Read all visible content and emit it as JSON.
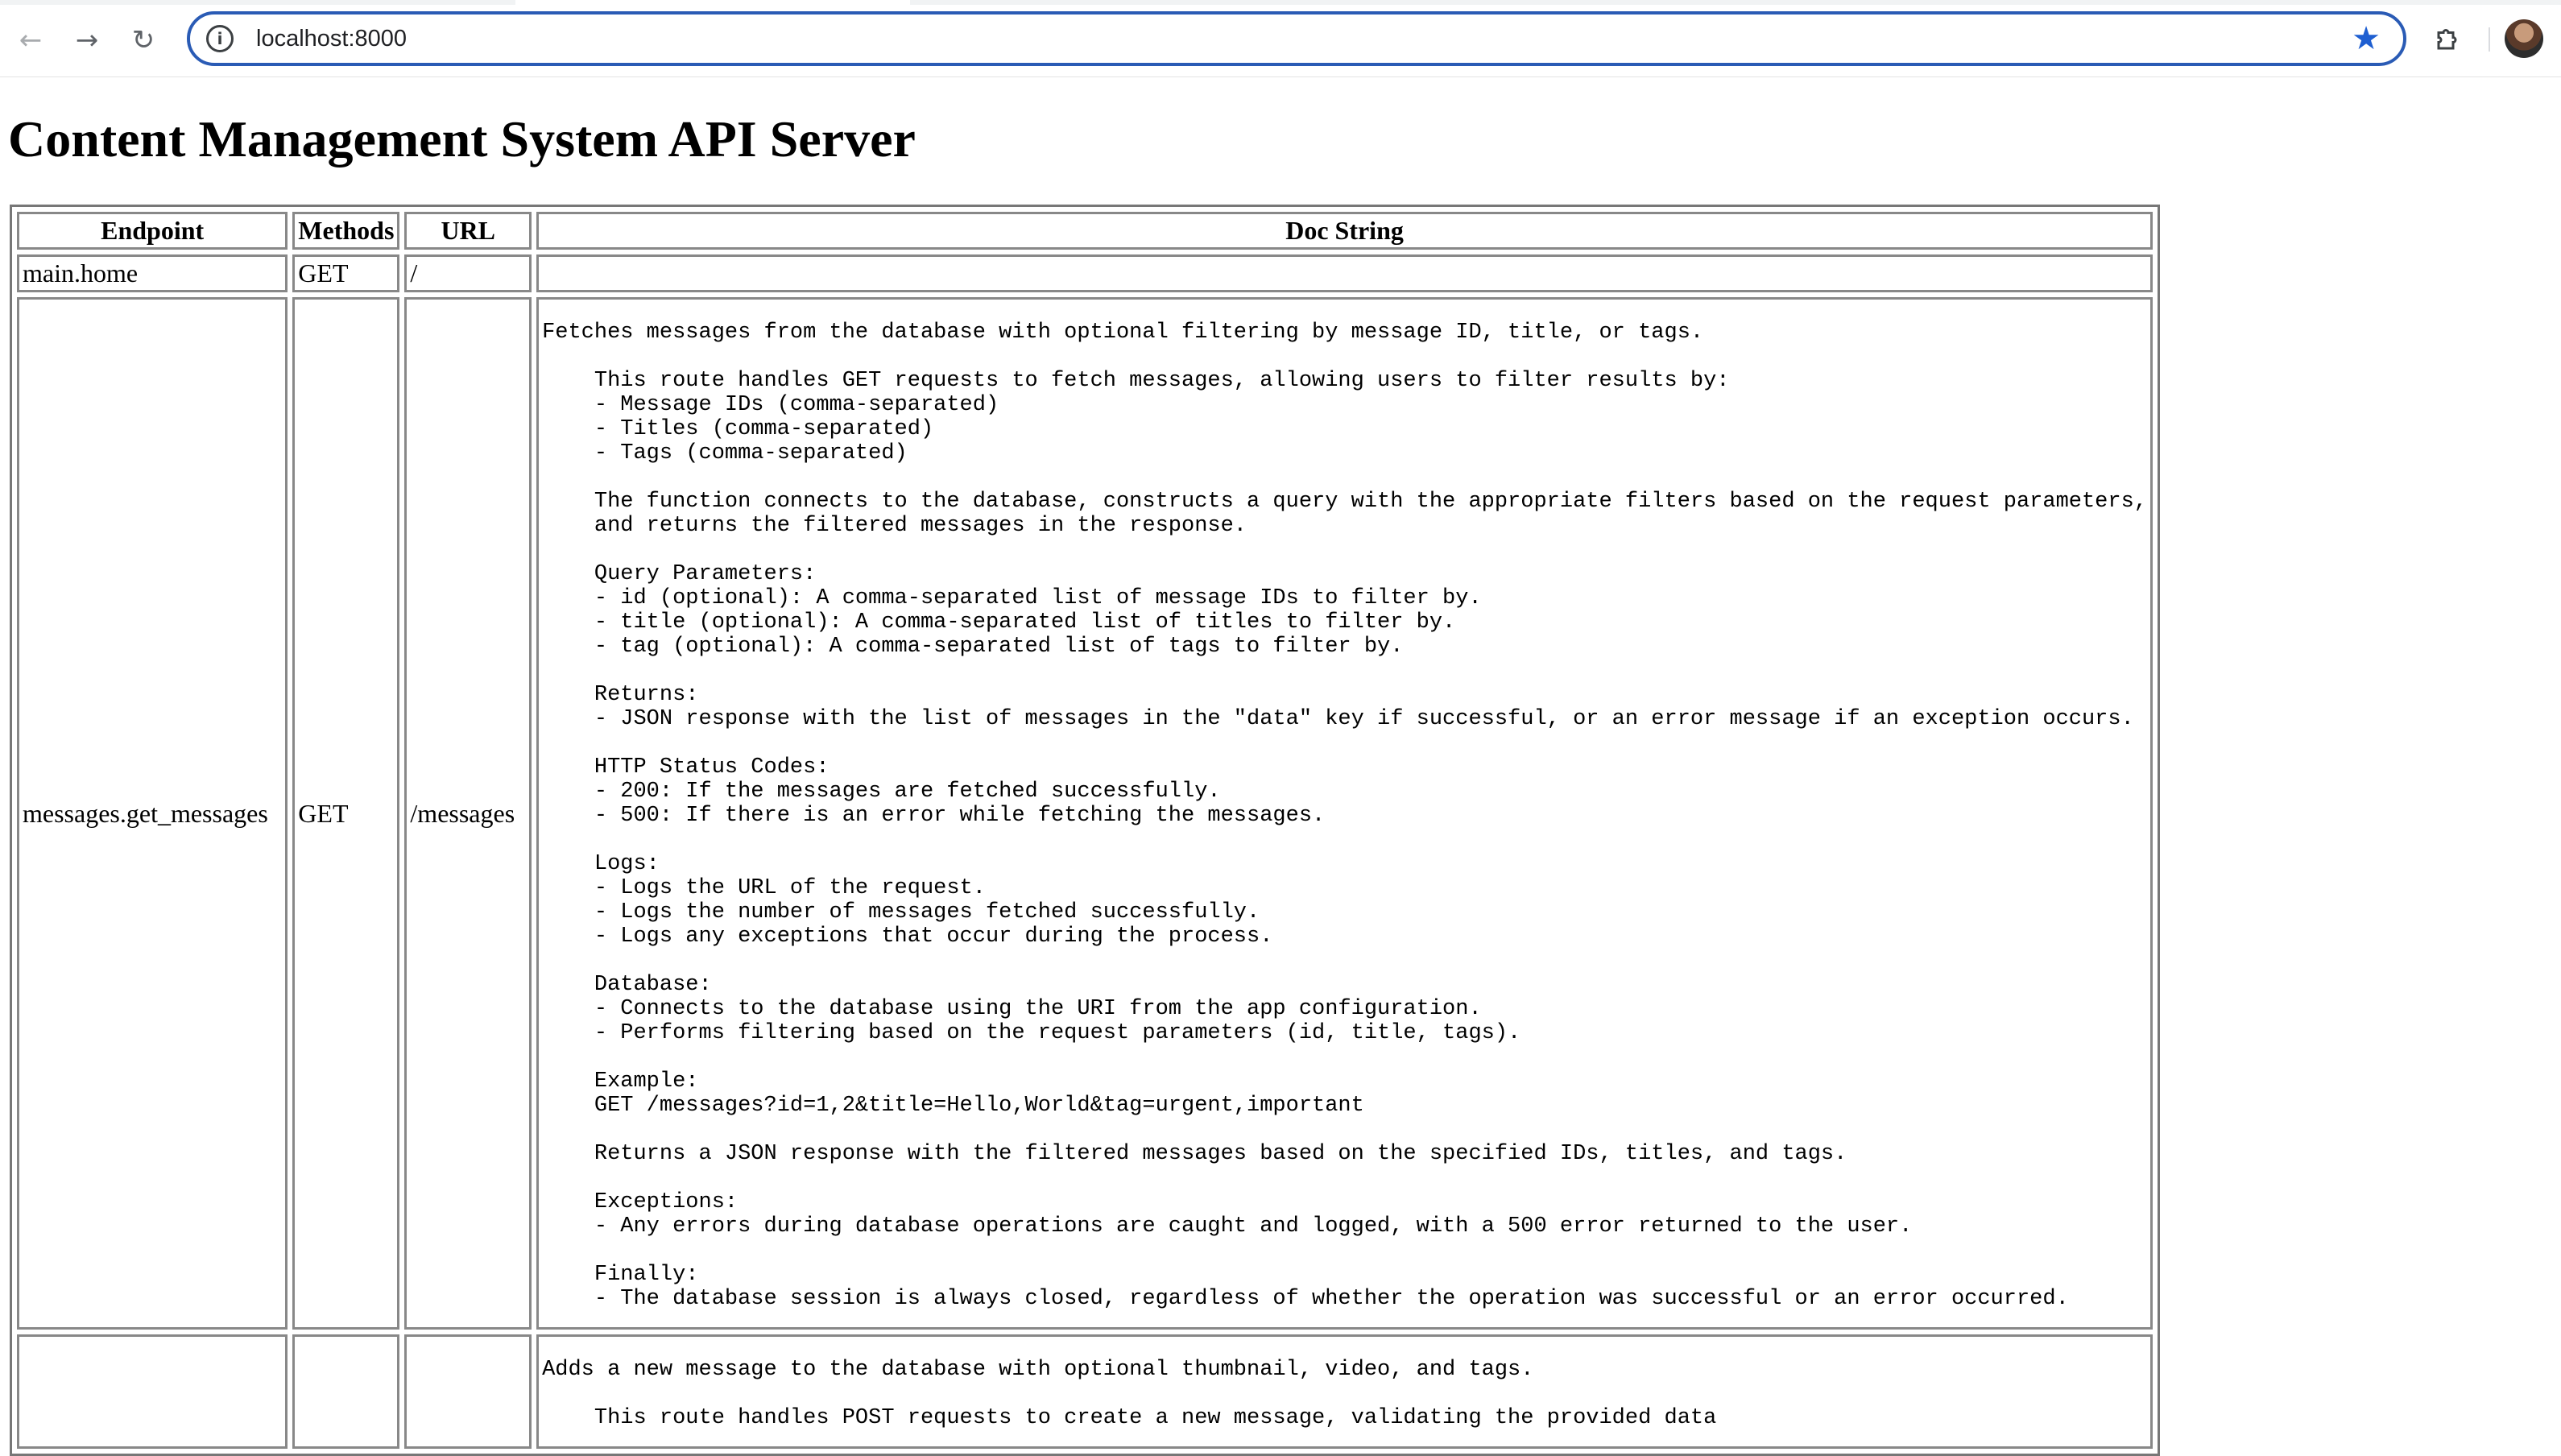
{
  "browser": {
    "url": "localhost:8000"
  },
  "page": {
    "title": "Content Management System API Server"
  },
  "table": {
    "headers": {
      "endpoint": "Endpoint",
      "methods": "Methods",
      "url": "URL",
      "doc": "Doc String"
    },
    "rows": [
      {
        "endpoint": "main.home",
        "methods": "GET",
        "url": "/",
        "doc": ""
      },
      {
        "endpoint": "messages.get_messages",
        "methods": "GET",
        "url": "/messages",
        "doc": "Fetches messages from the database with optional filtering by message ID, title, or tags.\n\n    This route handles GET requests to fetch messages, allowing users to filter results by:\n    - Message IDs (comma-separated)\n    - Titles (comma-separated)\n    - Tags (comma-separated)\n\n    The function connects to the database, constructs a query with the appropriate filters based on the request parameters,\n    and returns the filtered messages in the response.\n\n    Query Parameters:\n    - id (optional): A comma-separated list of message IDs to filter by.\n    - title (optional): A comma-separated list of titles to filter by.\n    - tag (optional): A comma-separated list of tags to filter by.\n\n    Returns:\n    - JSON response with the list of messages in the \"data\" key if successful, or an error message if an exception occurs.\n\n    HTTP Status Codes:\n    - 200: If the messages are fetched successfully.\n    - 500: If there is an error while fetching the messages.\n\n    Logs:\n    - Logs the URL of the request.\n    - Logs the number of messages fetched successfully.\n    - Logs any exceptions that occur during the process.\n\n    Database:\n    - Connects to the database using the URI from the app configuration.\n    - Performs filtering based on the request parameters (id, title, tags).\n\n    Example:\n    GET /messages?id=1,2&title=Hello,World&tag=urgent,important\n\n    Returns a JSON response with the filtered messages based on the specified IDs, titles, and tags.\n\n    Exceptions:\n    - Any errors during database operations are caught and logged, with a 500 error returned to the user.\n\n    Finally:\n    - The database session is always closed, regardless of whether the operation was successful or an error occurred."
      },
      {
        "endpoint": "",
        "methods": "",
        "url": "",
        "doc": "Adds a new message to the database with optional thumbnail, video, and tags.\n\n    This route handles POST requests to create a new message, validating the provided data"
      }
    ]
  },
  "icons": {
    "back": "arrow-left-icon",
    "forward": "arrow-right-icon",
    "reload": "reload-icon",
    "site_info": "info-icon",
    "bookmark": "star-icon",
    "extensions": "puzzle-icon",
    "profile": "avatar"
  },
  "colors": {
    "omnibox_border": "#2a5bb5",
    "bookmark_star": "#1f5fd1"
  }
}
